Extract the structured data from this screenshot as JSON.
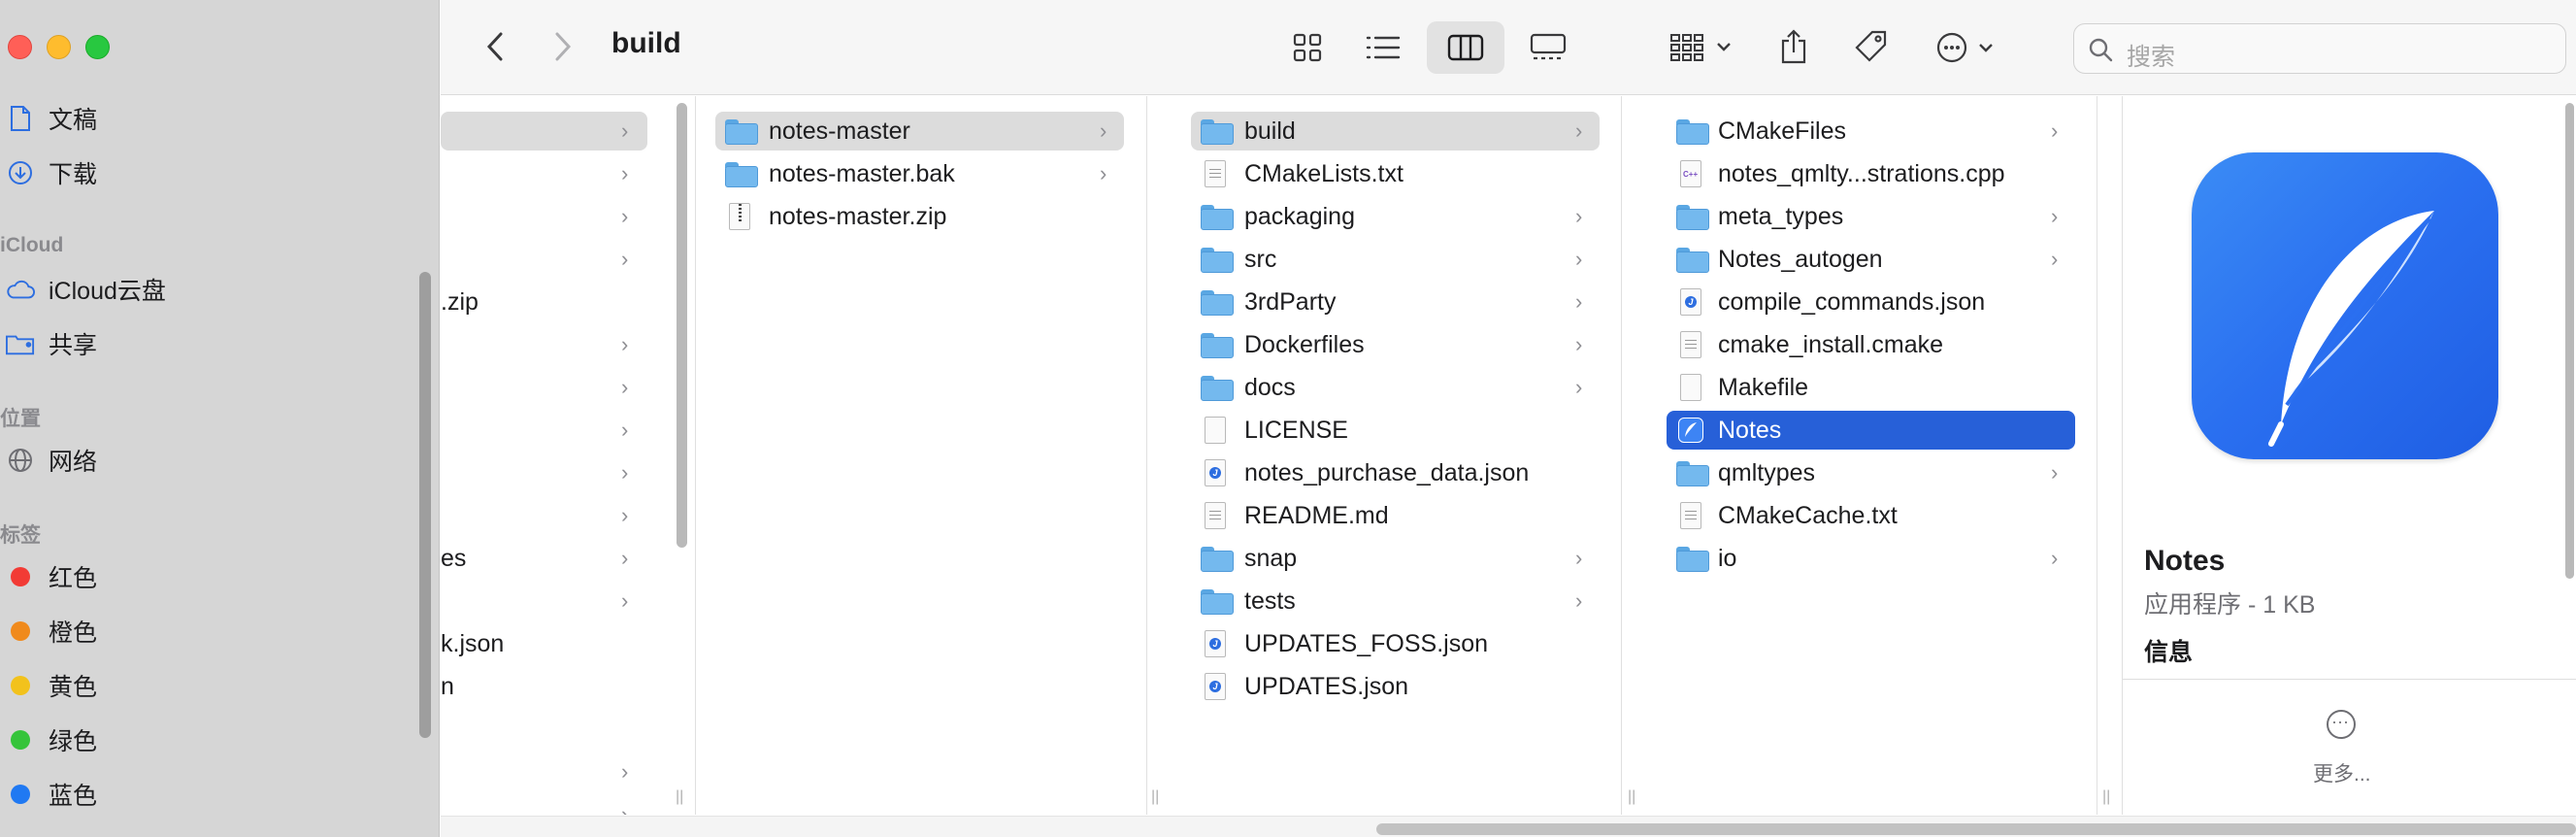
{
  "window": {
    "title": "build"
  },
  "sidebar": {
    "items_top": [
      {
        "label": "文稿",
        "icon": "document-icon"
      },
      {
        "label": "下载",
        "icon": "download-icon"
      }
    ],
    "sections": {
      "icloud": "iCloud",
      "location": "位置",
      "tags": "标签"
    },
    "icloud_items": [
      {
        "label": "iCloud云盘",
        "icon": "cloud-icon"
      },
      {
        "label": "共享",
        "icon": "shared-folder-icon"
      }
    ],
    "location_items": [
      {
        "label": "网络",
        "icon": "globe-icon"
      }
    ],
    "tags": [
      {
        "label": "红色",
        "color": "#f23b35"
      },
      {
        "label": "橙色",
        "color": "#f08a1c"
      },
      {
        "label": "黄色",
        "color": "#f2c21c"
      },
      {
        "label": "绿色",
        "color": "#35c43a"
      },
      {
        "label": "蓝色",
        "color": "#2079f2"
      }
    ]
  },
  "toolbar": {
    "back": "back-chevron-icon",
    "forward": "forward-chevron-icon",
    "views": [
      "icon-view",
      "list-view",
      "column-view",
      "gallery-view"
    ],
    "selected_view": "column-view",
    "search_placeholder": "搜索"
  },
  "columns": {
    "col0_partial": [
      ".zip",
      "es",
      "k.json",
      "n"
    ],
    "col1": [
      {
        "name": "notes-master",
        "type": "folder",
        "selected": true
      },
      {
        "name": "notes-master.bak",
        "type": "folder"
      },
      {
        "name": "notes-master.zip",
        "type": "zip"
      }
    ],
    "col2": [
      {
        "name": "build",
        "type": "folder",
        "selected": true
      },
      {
        "name": "CMakeLists.txt",
        "type": "text"
      },
      {
        "name": "packaging",
        "type": "folder"
      },
      {
        "name": "src",
        "type": "folder"
      },
      {
        "name": "3rdParty",
        "type": "folder"
      },
      {
        "name": "Dockerfiles",
        "type": "folder"
      },
      {
        "name": "docs",
        "type": "folder"
      },
      {
        "name": "LICENSE",
        "type": "blank"
      },
      {
        "name": "notes_purchase_data.json",
        "type": "json"
      },
      {
        "name": "README.md",
        "type": "text"
      },
      {
        "name": "snap",
        "type": "folder"
      },
      {
        "name": "tests",
        "type": "folder"
      },
      {
        "name": "UPDATES_FOSS.json",
        "type": "json"
      },
      {
        "name": "UPDATES.json",
        "type": "json"
      }
    ],
    "col3": [
      {
        "name": "CMakeFiles",
        "type": "folder"
      },
      {
        "name": "notes_qmlty...strations.cpp",
        "type": "cpp"
      },
      {
        "name": "meta_types",
        "type": "folder"
      },
      {
        "name": "Notes_autogen",
        "type": "folder"
      },
      {
        "name": "compile_commands.json",
        "type": "json"
      },
      {
        "name": "cmake_install.cmake",
        "type": "text"
      },
      {
        "name": "Makefile",
        "type": "blank"
      },
      {
        "name": "Notes",
        "type": "app",
        "selected": true
      },
      {
        "name": "qmltypes",
        "type": "folder"
      },
      {
        "name": "CMakeCache.txt",
        "type": "text"
      },
      {
        "name": "io",
        "type": "folder"
      }
    ]
  },
  "preview": {
    "name": "Notes",
    "kind": "应用程序 - 1 KB",
    "info": "信息",
    "more": "更多..."
  }
}
